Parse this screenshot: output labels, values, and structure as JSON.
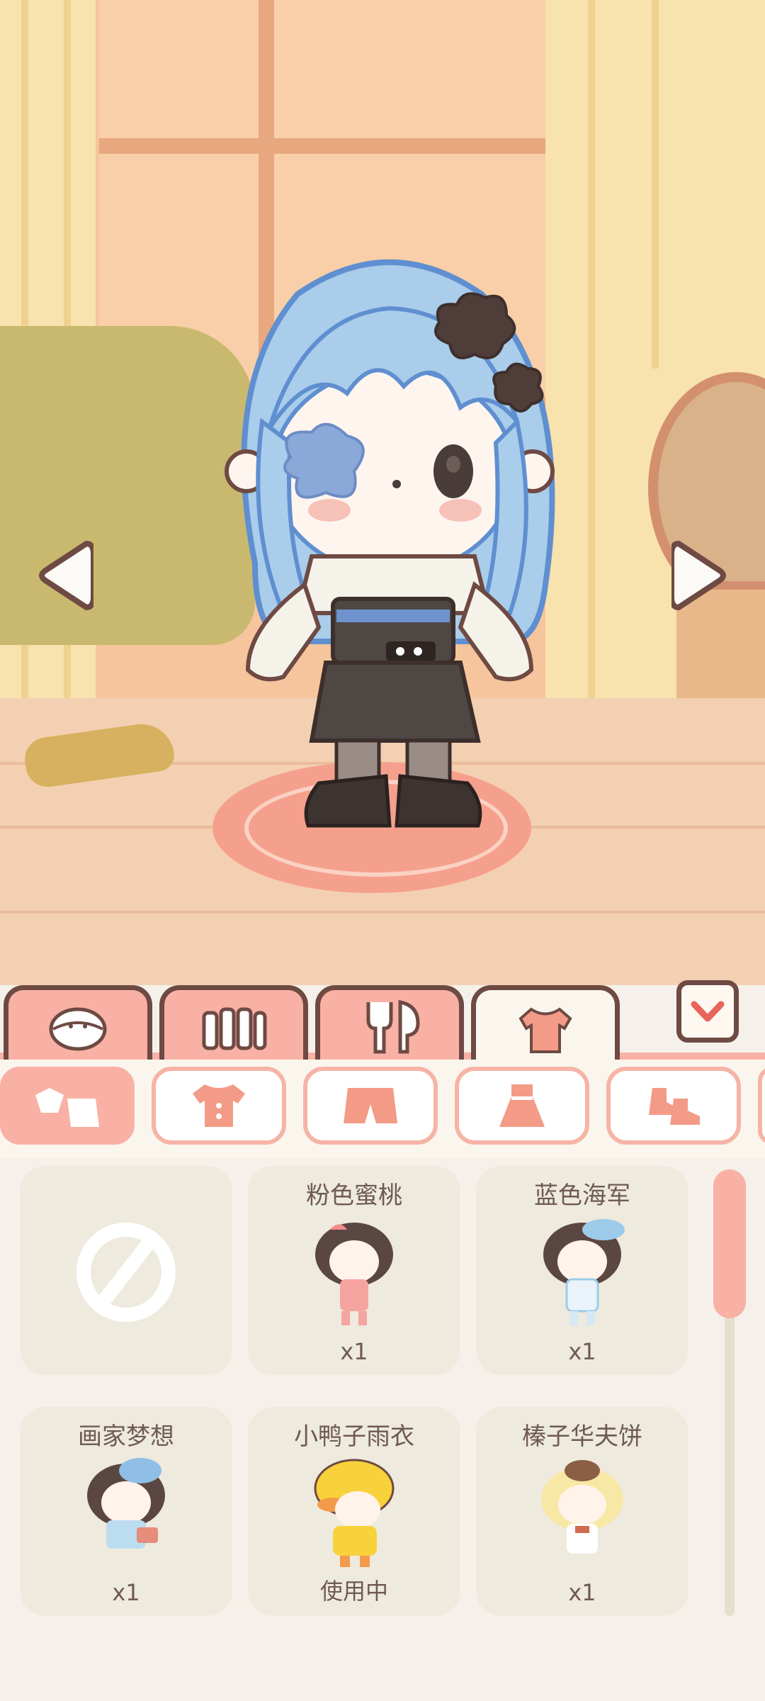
{
  "scene": {
    "prev_icon": "triangle-left-icon",
    "next_icon": "triangle-right-icon"
  },
  "category_tabs": [
    {
      "icon": "face-icon",
      "active": false
    },
    {
      "icon": "fence-icon",
      "active": false
    },
    {
      "icon": "fork-spoon-icon",
      "active": false
    },
    {
      "icon": "shirt-icon",
      "active": true
    }
  ],
  "collapse_icon": "chevron-down-icon",
  "subcategories": [
    {
      "icon": "all-clothes-icon",
      "active": true
    },
    {
      "icon": "top-icon",
      "active": false
    },
    {
      "icon": "pants-icon",
      "active": false
    },
    {
      "icon": "dress-icon",
      "active": false
    },
    {
      "icon": "shoes-icon",
      "active": false
    }
  ],
  "items": [
    {
      "name": "",
      "count": "",
      "icon": "none-icon"
    },
    {
      "name": "粉色蜜桃",
      "count": "x1",
      "icon": "outfit-pink-peach"
    },
    {
      "name": "蓝色海军",
      "count": "x1",
      "icon": "outfit-blue-navy"
    },
    {
      "name": "画家梦想",
      "count": "x1",
      "icon": "outfit-painter-dream"
    },
    {
      "name": "小鸭子雨衣",
      "count": "使用中",
      "icon": "outfit-duck-raincoat"
    },
    {
      "name": "榛子华夫饼",
      "count": "x1",
      "icon": "outfit-hazelnut-waffle"
    }
  ],
  "colors": {
    "accent": "#f8b1a4",
    "outline": "#6e4a43",
    "hair": "#a9cdea",
    "panel": "#f5f1ea"
  }
}
